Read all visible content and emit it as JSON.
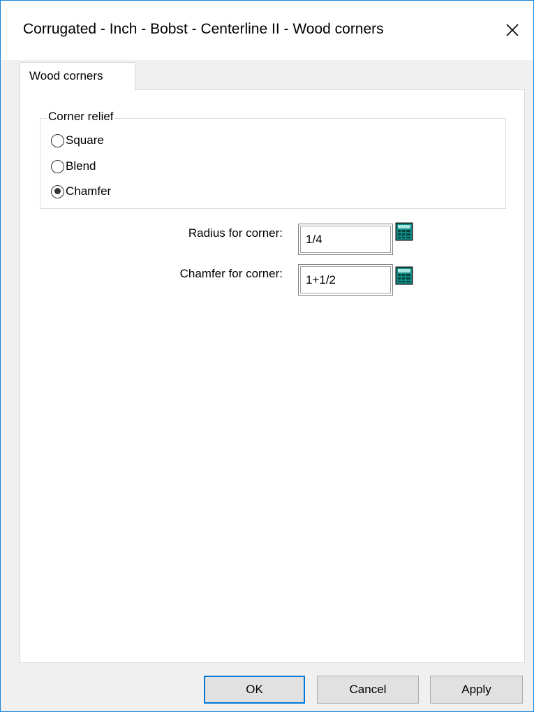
{
  "window": {
    "title": "Corrugated - Inch - Bobst - Centerline II - Wood corners",
    "close_icon": "close-icon"
  },
  "tabs": [
    {
      "label": "Wood corners",
      "selected": true
    }
  ],
  "corner_relief": {
    "legend": "Corner relief",
    "options": [
      {
        "label": "Square",
        "checked": false
      },
      {
        "label": "Blend",
        "checked": false
      },
      {
        "label": "Chamfer",
        "checked": true
      }
    ]
  },
  "fields": {
    "radius": {
      "label": "Radius for corner:",
      "value": "1/4",
      "icon": "calculator-icon"
    },
    "chamfer": {
      "label": "Chamfer for corner:",
      "value": "1+1/2",
      "icon": "calculator-icon"
    }
  },
  "buttons": {
    "ok": "OK",
    "cancel": "Cancel",
    "apply": "Apply"
  },
  "colors": {
    "accent": "#0078d7",
    "window_border": "#1883d7",
    "calculator_teal": "#008080"
  }
}
